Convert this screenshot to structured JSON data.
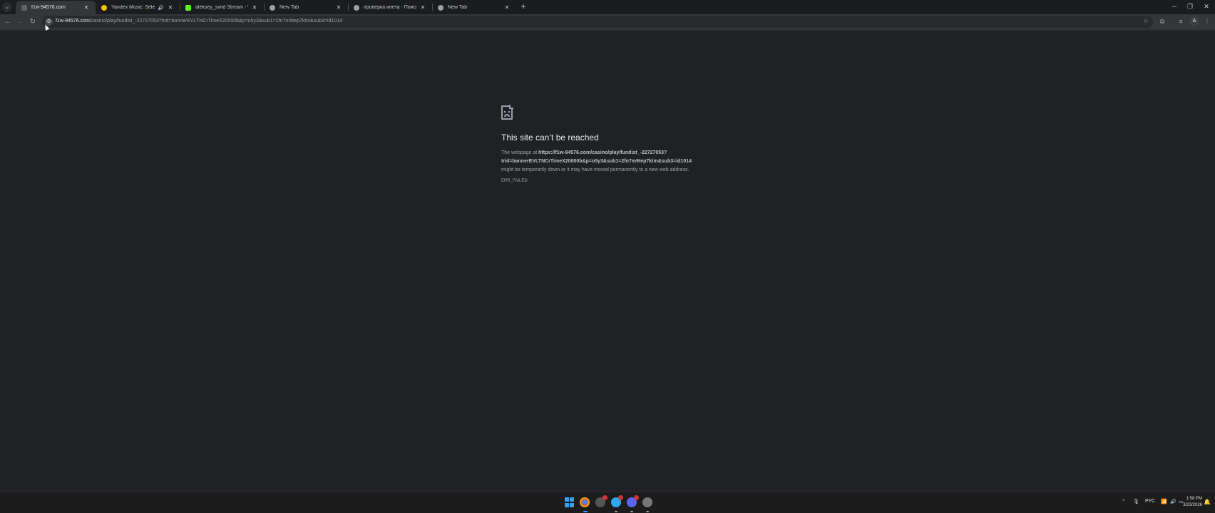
{
  "tabs": [
    {
      "title": "f1w-94576.com",
      "active": true,
      "favicon_color": "#5f6368"
    },
    {
      "title": "Yandex Music: Selecting m",
      "active": false,
      "favicon_color": "#f5c400",
      "audio": "🔊"
    },
    {
      "title": "aleksey_svnd Stream - Watch L",
      "active": false,
      "favicon_color": "#53fc18"
    },
    {
      "title": "New Tab",
      "active": false,
      "favicon_color": "#9aa0a6"
    },
    {
      "title": "проверка инета - Поиск в Goo",
      "active": false,
      "favicon_color": "#9aa0a6"
    },
    {
      "title": "New Tab",
      "active": false,
      "favicon_color": "#9aa0a6"
    }
  ],
  "toolbar": {
    "url_host": "f1w-94576.com",
    "url_rest": "/casino/play/fundist_-22727053?trid=bannerEVLTNCrTimeX20000b&p=o5y3&sub1=2fn7m9tep7ktm&sub3=id1014"
  },
  "error": {
    "title": "This site can’t be reached",
    "intro": "The webpage at ",
    "url_line1": "https://f1w-94576.com/casino/play/fundist_-22727053?",
    "url_line2": "trid=bannerEVLTNCrTimeX20000b&p=o5y3&sub1=2fn7m9tep7ktm&sub3=id1014",
    "tail": "might be temporarily down or it may have moved permanently to a new web address.",
    "code": "ERR_FAILED"
  },
  "taskbar": {
    "lang": "РУС",
    "time": "1:58 PM",
    "date": "3/23/2026"
  },
  "colors": {
    "page_bg": "#202124",
    "toolbar_bg": "#35363a",
    "taskbar_bg": "#1c1c1c",
    "accent": "#3aa0f0"
  }
}
